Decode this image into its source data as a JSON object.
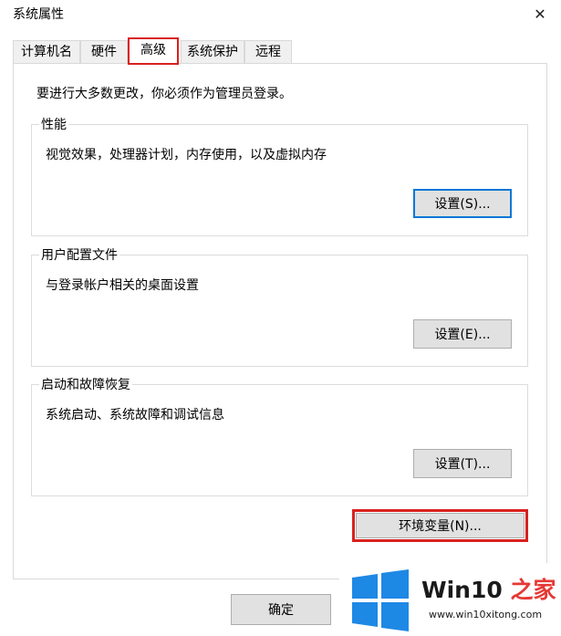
{
  "window": {
    "title": "系统属性",
    "close_glyph": "✕"
  },
  "tabs": [
    {
      "label": "计算机名",
      "active": false
    },
    {
      "label": "硬件",
      "active": false
    },
    {
      "label": "高级",
      "active": true
    },
    {
      "label": "系统保护",
      "active": false
    },
    {
      "label": "远程",
      "active": false
    }
  ],
  "advanced": {
    "notice": "要进行大多数更改，你必须作为管理员登录。",
    "performance": {
      "title": "性能",
      "desc": "视觉效果，处理器计划，内存使用，以及虚拟内存",
      "button": "设置(S)..."
    },
    "user_profiles": {
      "title": "用户配置文件",
      "desc": "与登录帐户相关的桌面设置",
      "button": "设置(E)..."
    },
    "startup_recovery": {
      "title": "启动和故障恢复",
      "desc": "系统启动、系统故障和调试信息",
      "button": "设置(T)..."
    },
    "env_button": "环境变量(N)..."
  },
  "footer": {
    "ok": "确定"
  },
  "watermark": {
    "brand_win": "Win10",
    "brand_suffix": " 之家",
    "url": "www.win10xitong.com",
    "colors": {
      "blue": "#1e88e5",
      "red": "#e53935"
    }
  },
  "colors": {
    "highlight": "#d9211f",
    "focus": "#0078d7"
  }
}
